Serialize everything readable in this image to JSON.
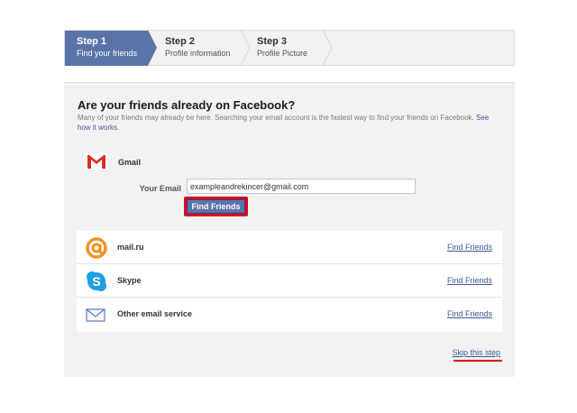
{
  "steps": [
    {
      "title": "Step 1",
      "subtitle": "Find your friends",
      "active": true
    },
    {
      "title": "Step 2",
      "subtitle": "Profile information",
      "active": false
    },
    {
      "title": "Step 3",
      "subtitle": "Profile Picture",
      "active": false
    }
  ],
  "main": {
    "heading": "Are your friends already on Facebook?",
    "intro_text": "Many of your friends may already be here. Searching your email account is the fastest way to find your friends on Facebook.",
    "intro_link": "See how it works."
  },
  "gmail": {
    "name": "Gmail",
    "email_label": "Your Email",
    "email_value": "exampleandrekincer@gmail.com",
    "button_label": "Find Friends"
  },
  "providers": [
    {
      "name": "mail.ru",
      "link": "Find Friends",
      "icon": "mailru-at-icon"
    },
    {
      "name": "Skype",
      "link": "Find Friends",
      "icon": "skype-icon"
    },
    {
      "name": "Other email service",
      "link": "Find Friends",
      "icon": "envelope-icon"
    }
  ],
  "skip_label": "Skip this step",
  "colors": {
    "active_step": "#5b74a8",
    "link": "#3b5998",
    "highlight": "#e0001b",
    "panel_bg": "#f2f2f2"
  }
}
